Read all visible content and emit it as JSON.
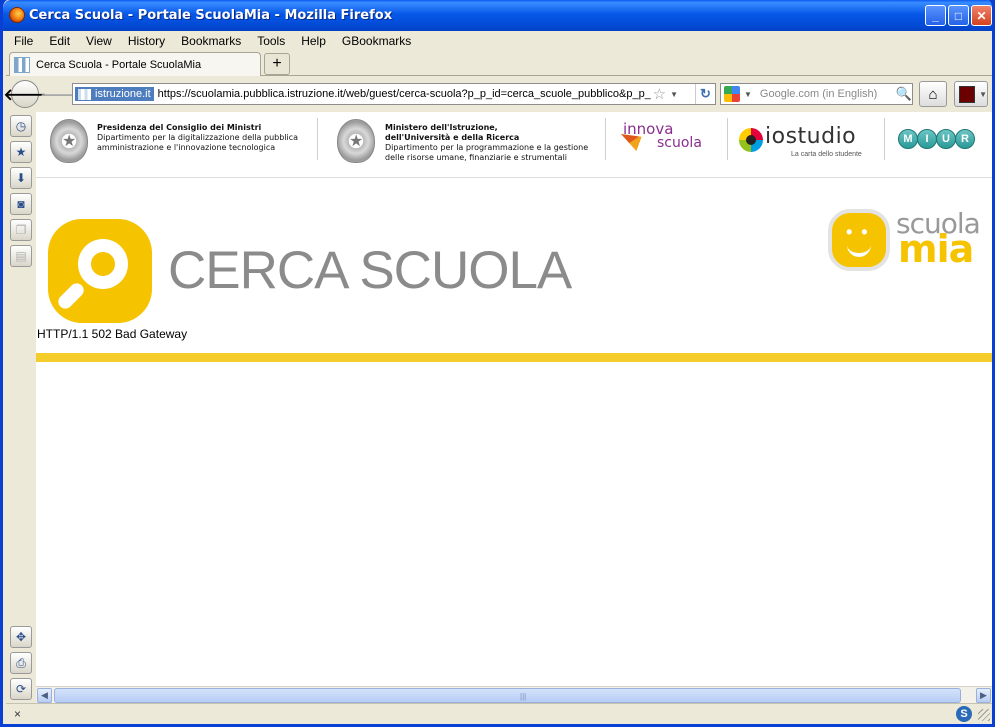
{
  "window": {
    "title": "Cerca Scuola - Portale ScuolaMia - Mozilla Firefox",
    "min_label": "_",
    "max_label": "□",
    "close_label": "✕"
  },
  "menubar": {
    "items": [
      "File",
      "Edit",
      "View",
      "History",
      "Bookmarks",
      "Tools",
      "Help",
      "GBookmarks"
    ]
  },
  "tabs": [
    {
      "label": "Cerca Scuola - Portale ScuolaMia"
    }
  ],
  "newtab_label": "+",
  "navbar": {
    "site_identity": "istruzione.it",
    "url": "https://scuolamia.pubblica.istruzione.it/web/guest/cerca-scuola?p_p_id=cerca_scuole_pubblico&p_p_li",
    "search_placeholder": "Google.com (in English)"
  },
  "gov_header": {
    "presidenza": {
      "title": "Presidenza del Consiglio dei Ministri",
      "line1": "Dipartimento per la digitalizzazione della pubblica",
      "line2": "amministrazione e l'innovazione tecnologica"
    },
    "ministero": {
      "title1": "Ministero dell'Istruzione,",
      "title2": "dell'Università e della Ricerca",
      "line1": "Dipartimento per la programmazione e la gestione",
      "line2": "delle risorse umane, finanziarie e strumentali"
    },
    "innova": {
      "w1": "innova",
      "w2": "scuola"
    },
    "iostudio": {
      "word": "iostudio",
      "tagline": "La carta dello studente"
    },
    "miur_letters": [
      "M",
      "I",
      "U",
      "R"
    ]
  },
  "page": {
    "title": "CERCA SCUOLA",
    "brand_w1": "scuola",
    "brand_w2": "mia",
    "error": "HTTP/1.1 502 Bad Gateway"
  },
  "statusbar": {
    "close_label": "×",
    "addon_label": "S"
  },
  "colors": {
    "accent_yellow": "#f5cd2a",
    "title_grey": "#8b8b8b",
    "xp_blue": "#0a3fd6"
  }
}
